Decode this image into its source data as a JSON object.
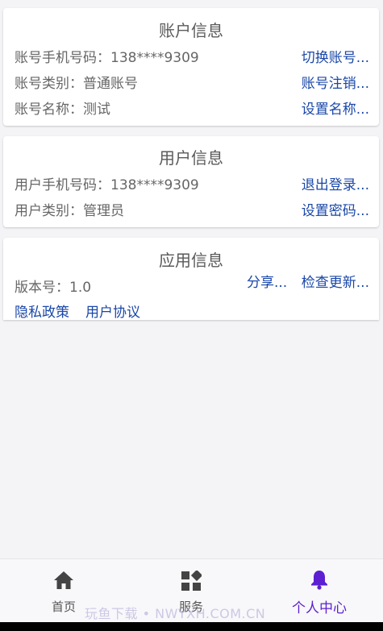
{
  "account": {
    "title": "账户信息",
    "phone_label": "账号手机号码：138****9309",
    "type_label": "账号类别：普通账号",
    "name_label": "账号名称：测试",
    "switch_link": "切换账号...",
    "cancel_link": "账号注销...",
    "set_name_link": "设置名称..."
  },
  "user": {
    "title": "用户信息",
    "phone_label": "用户手机号码：138****9309",
    "type_label": "用户类别：管理员",
    "logout_link": "退出登录...",
    "set_password_link": "设置密码..."
  },
  "app": {
    "title": "应用信息",
    "version_label": "版本号：1.0",
    "share_link": "分享...",
    "update_link": "检查更新...",
    "privacy_link": "隐私政策",
    "agreement_link": "用户协议"
  },
  "tabs": [
    {
      "label": "首页",
      "icon": "home-icon"
    },
    {
      "label": "服务",
      "icon": "grid-icon"
    },
    {
      "label": "个人中心",
      "icon": "bell-icon"
    }
  ],
  "colors": {
    "link": "#1a47a8",
    "active_tab": "#5c1fd1"
  },
  "watermark": "玩鱼下载 • NWYXH.COM.CN"
}
